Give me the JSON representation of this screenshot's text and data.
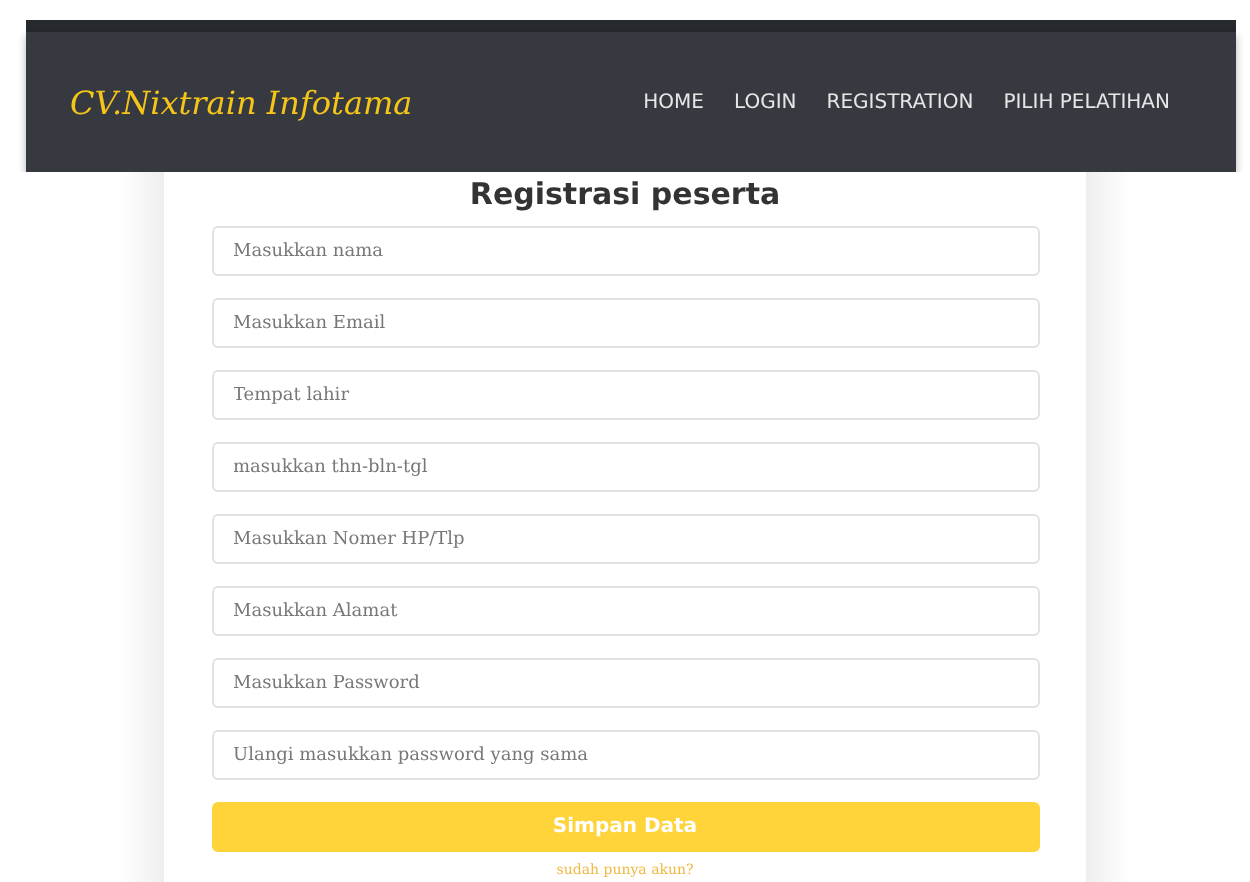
{
  "navbar": {
    "brand": "CV.Nixtrain Infotama",
    "links": [
      {
        "label": "HOME"
      },
      {
        "label": "LOGIN"
      },
      {
        "label": "REGISTRATION"
      },
      {
        "label": "PILIH PELATIHAN"
      }
    ]
  },
  "form": {
    "title": "Registrasi peserta",
    "fields": [
      {
        "placeholder": "Masukkan nama"
      },
      {
        "placeholder": "Masukkan Email"
      },
      {
        "placeholder": "Tempat lahir"
      },
      {
        "placeholder": "masukkan thn-bln-tgl"
      },
      {
        "placeholder": "Masukkan Nomer HP/Tlp"
      },
      {
        "placeholder": "Masukkan Alamat"
      },
      {
        "placeholder": "Masukkan Password"
      },
      {
        "placeholder": "Ulangi masukkan password yang sama"
      }
    ],
    "submit": "Simpan Data",
    "link": "sudah punya akun?"
  }
}
